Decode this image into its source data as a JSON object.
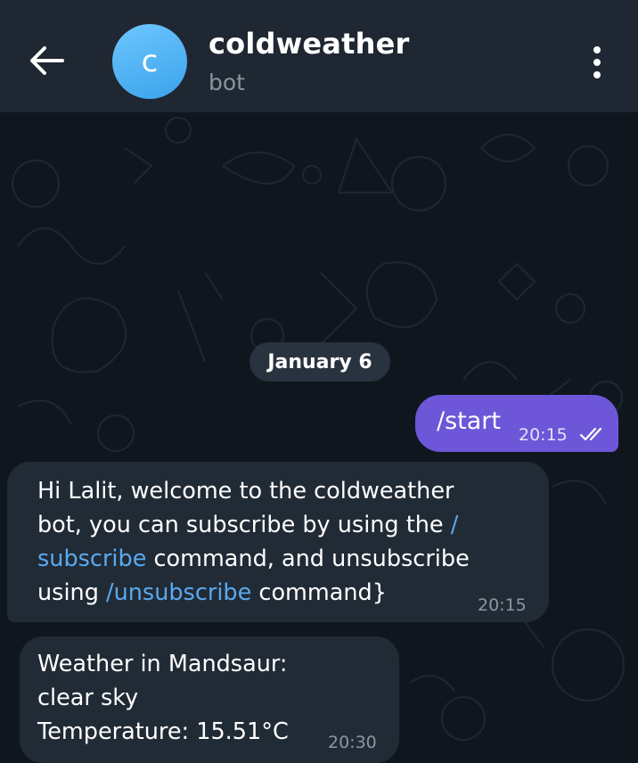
{
  "header": {
    "avatar_letter": "c",
    "chat_name": "coldweather",
    "status": "bot"
  },
  "date_separator": "January 6",
  "messages": [
    {
      "direction": "outgoing",
      "text": "/start",
      "time": "20:15",
      "status": "read"
    },
    {
      "direction": "incoming",
      "time": "20:15",
      "lines": [
        {
          "a": "Hi Lalit, welcome to the coldweather"
        },
        {
          "a": "bot, you can subscribe by using the ",
          "link": "/"
        },
        {
          "link": "subscribe",
          "b": " command, and unsubscribe"
        },
        {
          "a": "using ",
          "link": "/unsubscribe",
          "b": " command}"
        }
      ]
    },
    {
      "direction": "incoming",
      "time": "20:30",
      "lines": [
        "Weather in Mandsaur:",
        "clear sky",
        "Temperature: 15.51°C"
      ]
    }
  ],
  "colors": {
    "header_bg": "#1f2732",
    "chat_bg": "#0f161e",
    "outgoing_bubble": "#6d57d8",
    "incoming_bubble": "#212b36",
    "link": "#5aa9ef",
    "avatar": "#4aaee9"
  },
  "icons": [
    "back-arrow-icon",
    "more-vertical-icon",
    "double-check-icon"
  ]
}
